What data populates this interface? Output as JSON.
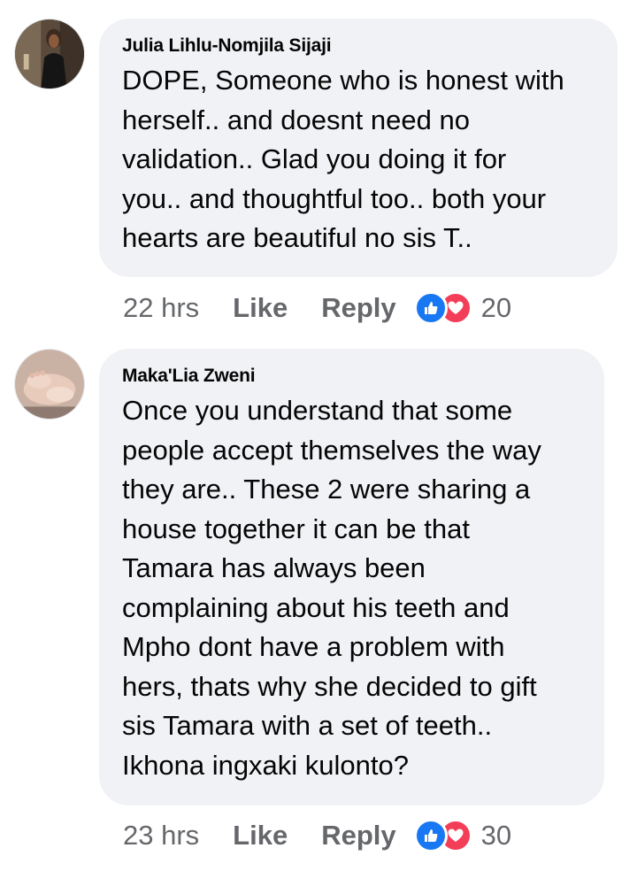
{
  "comments": [
    {
      "author": "Julia Lihlu-Nomjila Sijaji",
      "text": "DOPE, Someone who is honest with\nherself.. and doesnt need no\nvalidation.. Glad you doing it for\nyou.. and thoughtful too..  both your\nhearts are beautiful no sis T..",
      "time": "22 hrs",
      "like_label": "Like",
      "reply_label": "Reply",
      "reaction_icons": [
        "like-icon",
        "love-icon"
      ],
      "reaction_count": "20",
      "avatar_icon": "profile-photo-woman"
    },
    {
      "author": "Maka'Lia Zweni",
      "text": "Once you understand that some\npeople accept themselves the way\nthey are.. These 2 were sharing a\nhouse together it can be that\nTamara has always been\ncomplaining about his teeth and\nMpho dont have a problem with\nhers, thats why she decided to gift\nsis Tamara with a set of teeth..\nIkhona ingxaki kulonto?",
      "time": "23 hrs",
      "like_label": "Like",
      "reply_label": "Reply",
      "reaction_icons": [
        "like-icon",
        "love-icon"
      ],
      "reaction_count": "30",
      "avatar_icon": "profile-photo-baby-feet"
    }
  ],
  "colors": {
    "bubble_bg": "#f0f2f5",
    "secondary_text": "#65676b",
    "like_blue": "#1877f2",
    "love_red": "#f33e58"
  }
}
